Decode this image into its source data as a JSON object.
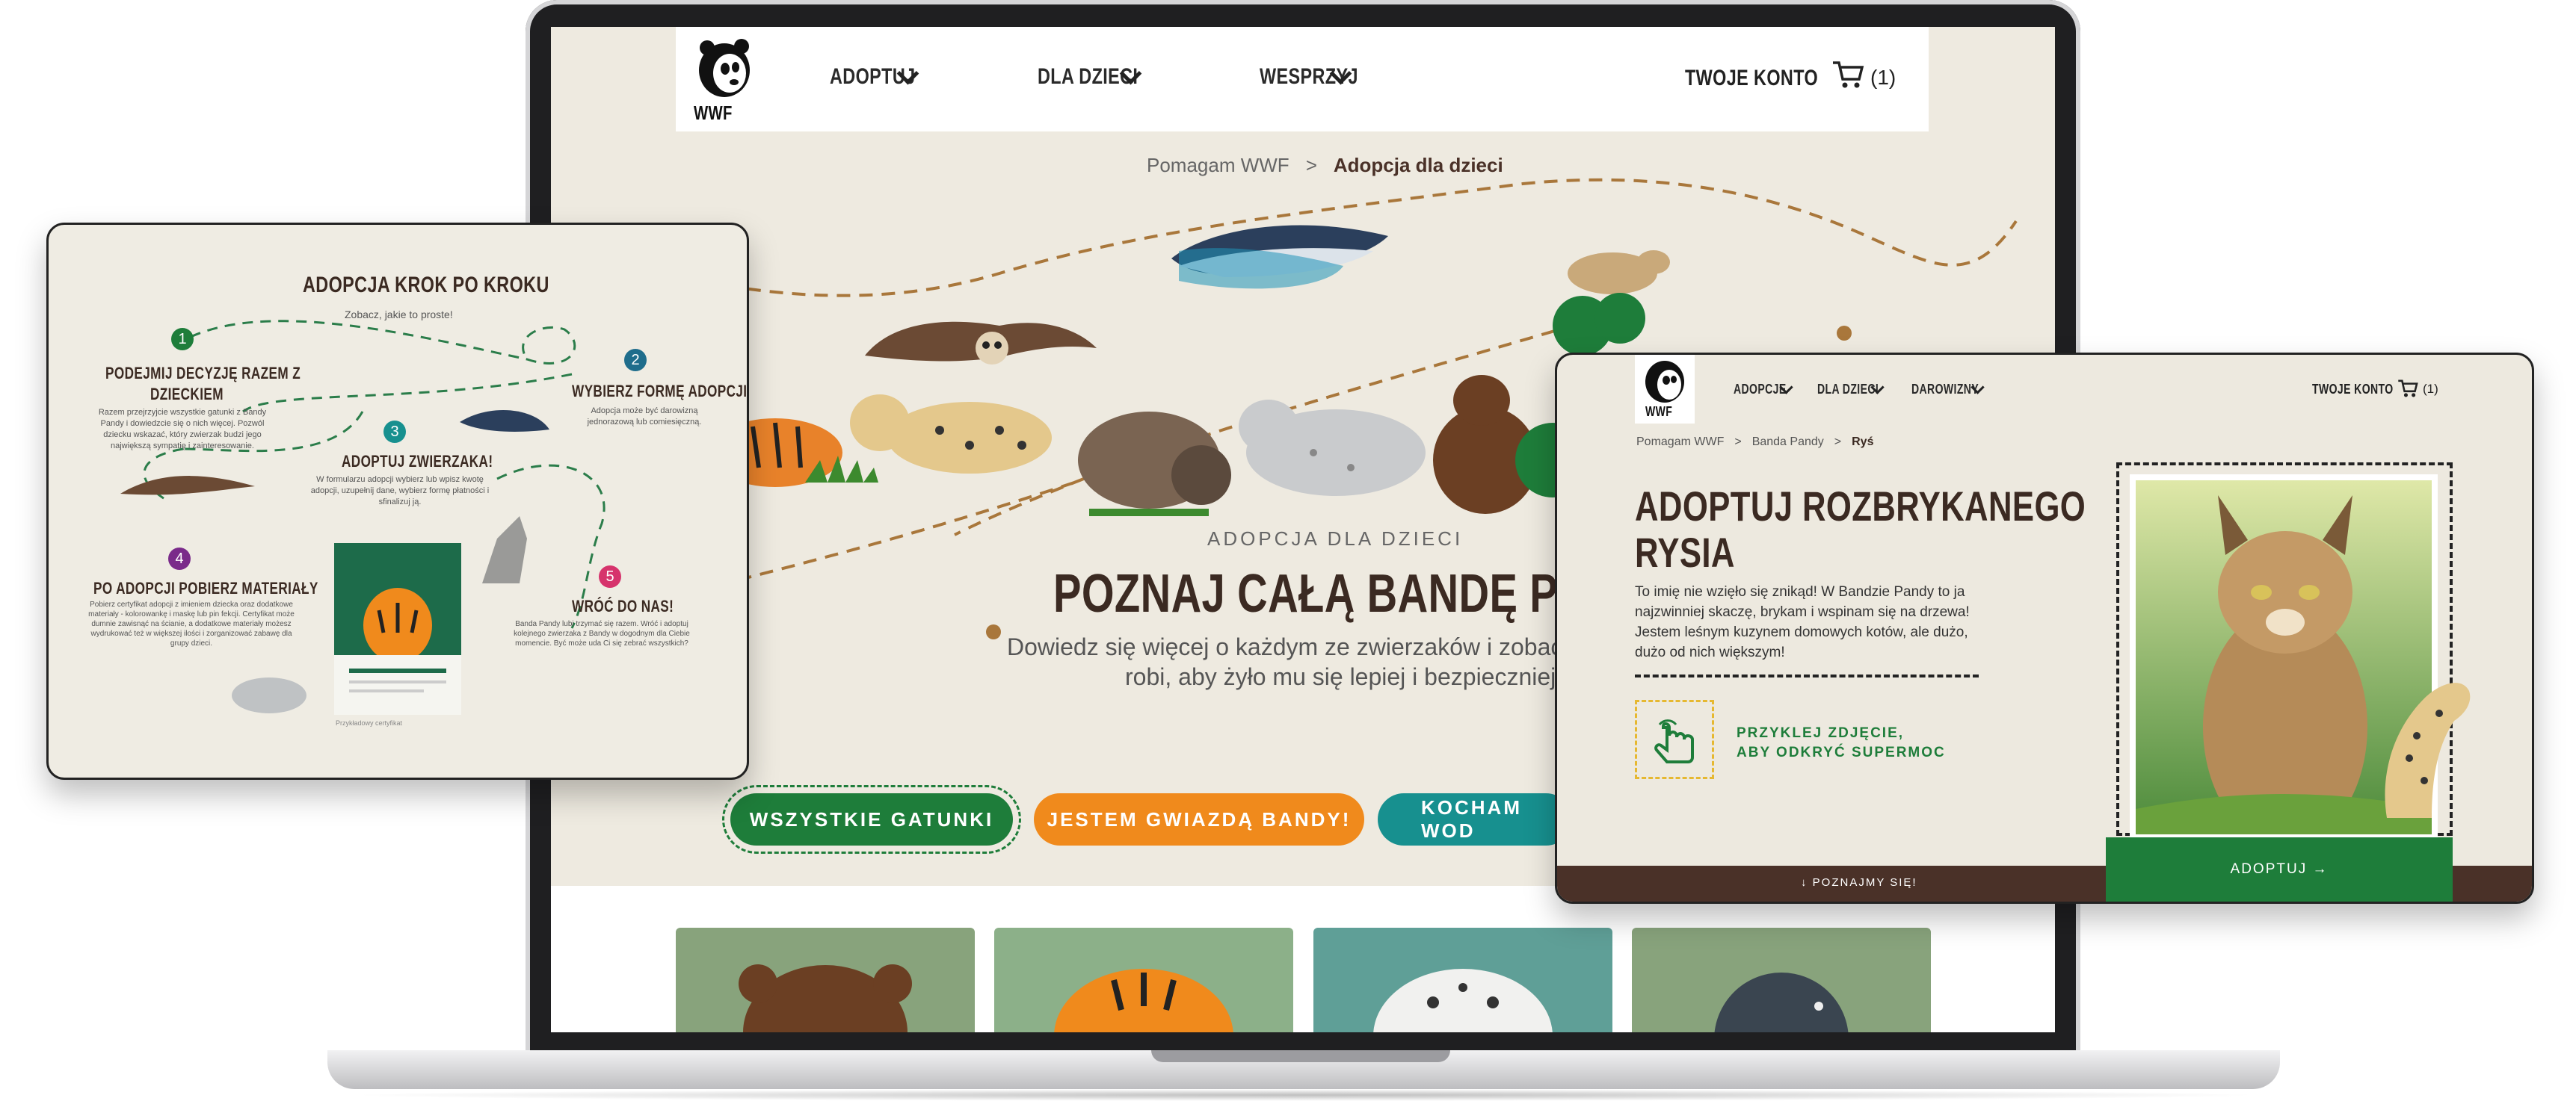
{
  "colors": {
    "bg": "#eeeae0",
    "brown": "#4a3128",
    "green": "#1e7d3a",
    "orange": "#f08a1c",
    "teal": "#17908f",
    "dark": "#222222"
  },
  "main": {
    "nav": {
      "logo_text": "WWF",
      "items": [
        "ADOPTUJ",
        "DLA DZIECI",
        "WESPRZYJ"
      ],
      "account": "TWOJE KONTO",
      "cart": "(1)"
    },
    "breadcrumb": {
      "parent": "Pomagam WWF",
      "sep": ">",
      "current": "Adopcja dla dzieci"
    },
    "hero": {
      "eyebrow": "ADOPCJA DLA DZIECI",
      "title": "POZNAJ CAŁĄ BANDĘ PANDY",
      "subtitle_line1": "Dowiedz się więcej o każdym ze zwierzaków i zobacz, co W",
      "subtitle_line2": "robi, aby żyło mu się lepiej i bezpieczniej"
    },
    "buttons": [
      "WSZYSTKIE GATUNKI",
      "JESTEM GWIAZDĄ BANDY!",
      "KOCHAM WOD"
    ]
  },
  "left_panel": {
    "title": "ADOPCJA KROK PO KROKU",
    "subtitle": "Zobacz, jakie to proste!",
    "steps": [
      {
        "num": "1",
        "title_line1": "PODEJMIJ DECYZJĘ RAZEM Z",
        "title_line2": "DZIECKIEM",
        "text": "Razem przejrzyjcie wszystkie gatunki z Bandy Pandy i dowiedzcie się o nich więcej. Pozwól dziecku wskazać, który zwierzak budzi jego największą sympatię i zainteresowanie."
      },
      {
        "num": "2",
        "title_line1": "WYBIERZ FORMĘ ADOPCJI",
        "title_line2": "",
        "text": "Adopcja może być darowizną jednorazową lub comiesięczną."
      },
      {
        "num": "3",
        "title_line1": "ADOPTUJ ZWIERZAKA!",
        "title_line2": "",
        "text": "W formularzu adopcji wybierz lub wpisz kwotę adopcji, uzupełnij dane, wybierz formę płatności i sfinalizuj ją."
      },
      {
        "num": "4",
        "title_line1": "PO ADOPCJI POBIERZ MATERIAŁY",
        "title_line2": "",
        "text": "Pobierz certyfikat adopcji z imieniem dziecka oraz dodatkowe materiały - kolorowankę i maskę lub pin fekcji. Certyfikat może dumnie zawisnąć na ścianie, a dodatkowe materiały możesz wydrukować też w większej ilości i zorganizować zabawę dla grupy dzieci."
      },
      {
        "num": "5",
        "title_line1": "WRÓĆ DO NAS!",
        "title_line2": "",
        "text": "Banda Pandy lubi trzymać się razem. Wróć i adoptuj kolejnego zwierzaka z Bandy w dogodnym dla Ciebie momencie. Być może uda Ci się zebrać wszystkich?"
      }
    ],
    "caption": "Przykładowy certyfikat"
  },
  "right_panel": {
    "nav": {
      "logo_text": "WWF",
      "items": [
        "ADOPCJE",
        "DLA DZIECI",
        "DAROWIZNY"
      ],
      "account": "TWOJE KONTO",
      "cart": "(1)"
    },
    "breadcrumb": {
      "a": "Pomagam WWF",
      "b": "Banda Pandy",
      "c": "Ryś",
      "sep": ">"
    },
    "title_line1": "ADOPTUJ ROZBRYKANEGO",
    "title_line2": "RYSIA",
    "text_lines": [
      "To imię nie wzięło się znikąd! W Bandzie Pandy to ja",
      "najzwinniej skaczę, brykam i wspinam się na drzewa!",
      "Jestem leśnym kuzynem domowych kotów, ale dużo,",
      "dużo od nich większym!"
    ],
    "sticker_line1": "PRZYKLEJ ZDJĘCIE,",
    "sticker_line2": "ABY ODKRYĆ SUPERMOC",
    "footer": "↓ POZNAJMY SIĘ!",
    "adopt": "ADOPTUJ →"
  }
}
